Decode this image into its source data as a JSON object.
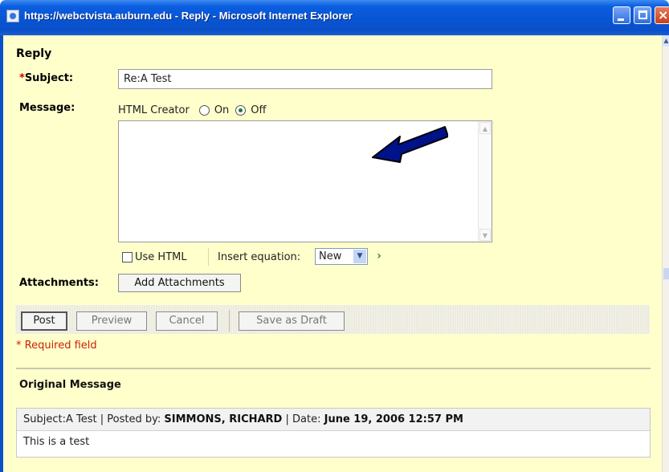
{
  "window": {
    "title": "https://webctvista.auburn.edu - Reply - Microsoft Internet Explorer"
  },
  "form": {
    "heading": "Reply",
    "subject_required_mark": "*",
    "subject_label": "Subject:",
    "subject_value": "Re:A Test",
    "message_label": "Message:",
    "html_creator_label": "HTML Creator",
    "radio_on_label": "On",
    "radio_off_label": "Off",
    "html_creator_selected": "Off",
    "use_html_label": "Use HTML",
    "use_html_checked": false,
    "insert_equation_label": "Insert equation:",
    "equation_select_value": "New",
    "attachments_label": "Attachments:",
    "add_attachments_label": "Add Attachments"
  },
  "actions": {
    "post_label": "Post",
    "preview_label": "Preview",
    "cancel_label": "Cancel",
    "save_draft_label": "Save as Draft"
  },
  "required_note": "* Required field",
  "original": {
    "section_title": "Original Message",
    "subject_prefix": "Subject:",
    "subject": "A Test",
    "posted_by_prefix": "Posted by:",
    "posted_by": "SIMMONS, RICHARD",
    "date_prefix": "Date:",
    "date": "June 19, 2006 12:57 PM",
    "body": "This is a test"
  },
  "icons": {
    "arrow": "blue-arrow-icon",
    "go": "green-chevron-icon"
  },
  "colors": {
    "page_background": "#ffffcc",
    "titlebar": "#0a5ee0",
    "required": "#cc0000",
    "arrow": "#00128a"
  }
}
